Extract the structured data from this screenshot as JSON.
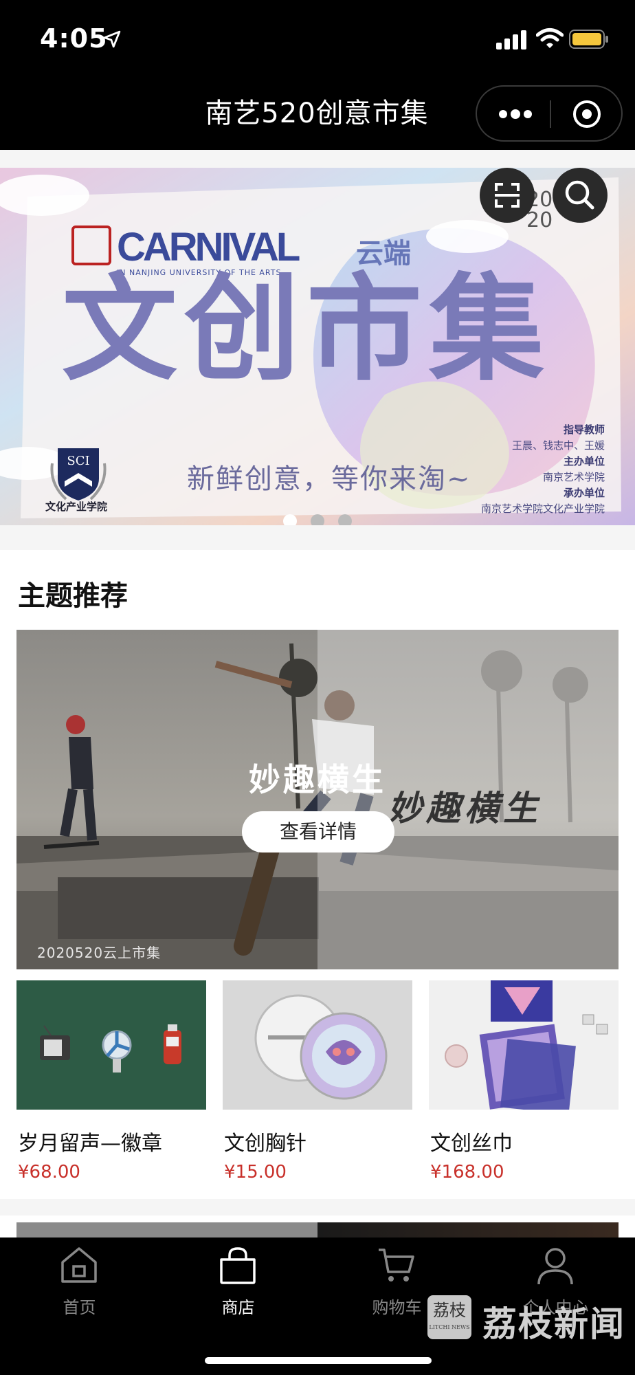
{
  "status_bar": {
    "time": "4:05"
  },
  "nav": {
    "title": "南艺520创意市集"
  },
  "banner": {
    "carnival": "CARNIVAL",
    "carnival_sub": "IN NANJING UNIVERSITY OF THE ARTS",
    "cloud_word": "云端",
    "headline": "文创市集",
    "slogan": "新鲜创意，等你来淘~",
    "school_badge": "SCI",
    "school_name": "文化产业学院",
    "year_top": "20",
    "year_bottom": "20",
    "credits": [
      {
        "text": "指导教师",
        "heading": true
      },
      {
        "text": "王晨、钱志中、王媛",
        "heading": false
      },
      {
        "text": "主办单位",
        "heading": true
      },
      {
        "text": "南京艺术学院",
        "heading": false
      },
      {
        "text": "承办单位",
        "heading": true
      },
      {
        "text": "南京艺术学院文化产业学院",
        "heading": false
      }
    ],
    "pagination_count": 3,
    "pagination_active": 0
  },
  "section": {
    "title": "主题推荐",
    "hero": {
      "title": "妙趣横生",
      "title_overlay": "妙趣横生",
      "button_label": "查看详情",
      "caption": "2020520云上市集"
    },
    "products": [
      {
        "name": "岁月留声—徽章",
        "price": "¥68.00"
      },
      {
        "name": "文创胸针",
        "price": "¥15.00"
      },
      {
        "name": "文创丝巾",
        "price": "¥168.00"
      }
    ]
  },
  "tab_bar": {
    "tabs": [
      {
        "label": "首页",
        "icon": "home-icon",
        "active": false
      },
      {
        "label": "商店",
        "icon": "shopping-bag-icon",
        "active": true
      },
      {
        "label": "购物车",
        "icon": "cart-icon",
        "active": false
      },
      {
        "label": "个人中心",
        "icon": "user-icon",
        "active": false
      }
    ]
  },
  "watermark": {
    "seal": "荔枝",
    "seal_sub": "LITCHI NEWS",
    "text": "荔枝新闻"
  },
  "colors": {
    "price": "#c8302a",
    "banner_text": "#7a7ab8",
    "tab_active": "#ffffff",
    "tab_inactive": "#888888"
  }
}
